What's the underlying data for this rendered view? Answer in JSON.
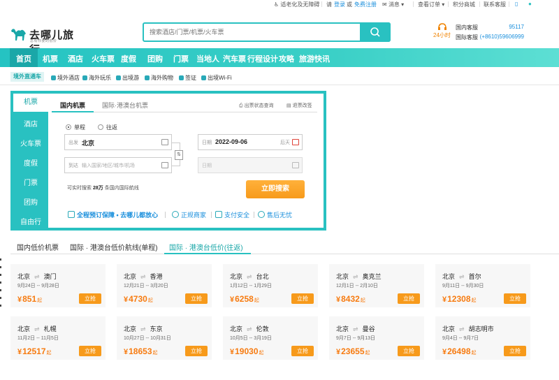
{
  "topbar": {
    "accessibility": "适老化及无障碍",
    "please": "请",
    "login": "登录",
    "and": "或",
    "register": "免费注册",
    "messages": "消息",
    "orders": "查看订单",
    "points_mall": "积分商城",
    "contact": "联系客服"
  },
  "header": {
    "logo_text": "去哪儿旅行",
    "logo_sub": "总有你要的低价",
    "search_placeholder": "搜索酒店/门票/机票/火车票",
    "service_24h": "24小时",
    "domestic_label": "国内客服",
    "domestic_number": "95117",
    "intl_label": "国际客服",
    "intl_number": "(+8610)59606999"
  },
  "nav": {
    "items": [
      "首页",
      "机票",
      "酒店",
      "火车票",
      "度假",
      "团购",
      "门票",
      "当地人",
      "汽车票",
      "行程设计",
      "攻略",
      "旅游快讯"
    ]
  },
  "subnav": {
    "tag": "境外直通车",
    "items": [
      "境外酒店",
      "海外玩乐",
      "出境游",
      "海外购物",
      "签证",
      "出境Wi-Fi"
    ]
  },
  "booking": {
    "side_items": [
      "机票",
      "酒店",
      "火车票",
      "度假",
      "门票",
      "团购",
      "自由行"
    ],
    "tabs": [
      "国内机票",
      "国际·港澳台机票"
    ],
    "link_status": "出票状态查询",
    "link_refund": "退票改签",
    "trip_oneway": "单程",
    "trip_round": "往返",
    "depart_label": "出发",
    "depart_value": "北京",
    "arrive_label": "到达",
    "arrive_placeholder": "输入国家/地区/城市/机场",
    "date_label": "日期",
    "date_value": "2022-09-06",
    "date_hint": "后天",
    "return_label": "日期",
    "hint_prefix": "可实时搜索",
    "hint_count": "28万",
    "hint_suffix": "条国内国际航线",
    "search_button": "立即搜索",
    "guarantees": [
      "全程预订保障 • 去哪儿都放心",
      "正规商家",
      "支付安全",
      "售后无忧"
    ]
  },
  "low_price": {
    "tabs": [
      "国内低价机票",
      "国际 · 港澳台低价航线(单程)",
      "国际 · 港澳台低价(往返)"
    ],
    "currency": "¥",
    "qi": "起",
    "buy_label": "立抢",
    "cards": [
      {
        "from": "北京",
        "to": "澳门",
        "dates": "9月24日 -- 9月28日",
        "price": "851"
      },
      {
        "from": "北京",
        "to": "香港",
        "dates": "12月21日 -- 3月20日",
        "price": "4730"
      },
      {
        "from": "北京",
        "to": "台北",
        "dates": "1月12日 -- 1月29日",
        "price": "6258"
      },
      {
        "from": "北京",
        "to": "奥克兰",
        "dates": "12月1日 -- 2月10日",
        "price": "8432"
      },
      {
        "from": "北京",
        "to": "首尔",
        "dates": "9月11日 -- 9月30日",
        "price": "12308"
      },
      {
        "from": "北京",
        "to": "札幌",
        "dates": "11月2日 -- 11月5日",
        "price": "12517"
      },
      {
        "from": "北京",
        "to": "东京",
        "dates": "10月27日 -- 10月31日",
        "price": "18653"
      },
      {
        "from": "北京",
        "to": "伦敦",
        "dates": "10月5日 -- 3月19日",
        "price": "19030"
      },
      {
        "from": "北京",
        "to": "曼谷",
        "dates": "9月7日 -- 9月13日",
        "price": "23655"
      },
      {
        "from": "北京",
        "to": "胡志明市",
        "dates": "9月4日 -- 9月7日",
        "price": "26498"
      }
    ]
  },
  "colors": {
    "brand": "#29c1c1",
    "orange": "#f79a1b",
    "price": "#f77b10",
    "link": "#1a8fdc"
  }
}
